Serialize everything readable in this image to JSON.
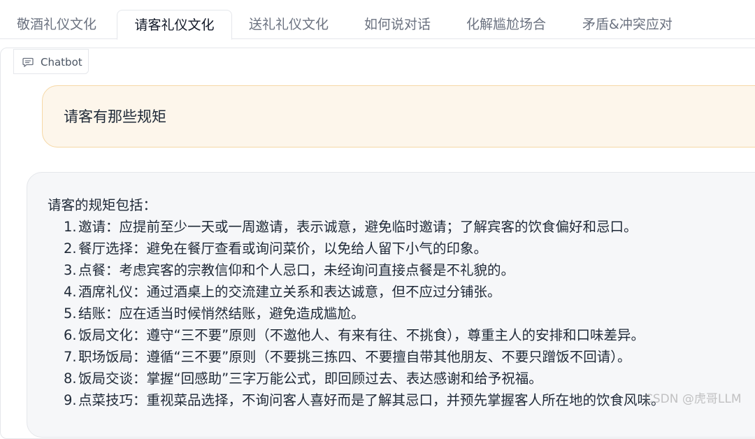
{
  "tabs": [
    {
      "label": "敬酒礼仪文化",
      "active": false
    },
    {
      "label": "请客礼仪文化",
      "active": true
    },
    {
      "label": "送礼礼仪文化",
      "active": false
    },
    {
      "label": "如何说对话",
      "active": false
    },
    {
      "label": "化解尴尬场合",
      "active": false
    },
    {
      "label": "矛盾&冲突应对",
      "active": false
    }
  ],
  "chatbot": {
    "label": "Chatbot",
    "icon": "chat-bubble-icon"
  },
  "messages": {
    "user": "请客有那些规矩",
    "bot": {
      "intro": "请客的规矩包括：",
      "items": [
        {
          "num": "1.",
          "text": "邀请：应提前至少一天或一周邀请，表示诚意，避免临时邀请；了解宾客的饮食偏好和忌口。"
        },
        {
          "num": "2.",
          "text": "餐厅选择：避免在餐厅查看或询问菜价，以免给人留下小气的印象。"
        },
        {
          "num": "3.",
          "text": "点餐：考虑宾客的宗教信仰和个人忌口，未经询问直接点餐是不礼貌的。"
        },
        {
          "num": "4.",
          "text": "酒席礼仪：通过酒桌上的交流建立关系和表达诚意，但不应过分铺张。"
        },
        {
          "num": "5.",
          "text": "结账：应在适当时候悄然结账，避免造成尴尬。"
        },
        {
          "num": "6.",
          "text": "饭局文化：遵守“三不要”原则（不邀他人、有来有往、不挑食），尊重主人的安排和口味差异。"
        },
        {
          "num": "7.",
          "text": "职场饭局：遵循“三不要”原则（不要挑三拣四、不要擅自带其他朋友、不要只蹭饭不回请）。"
        },
        {
          "num": "8.",
          "text": "饭局交谈：掌握“回感助”三字万能公式，即回顾过去、表达感谢和给予祝福。"
        },
        {
          "num": "9.",
          "text": "点菜技巧：重视菜品选择，不询问客人喜好而是了解其忌口，并预先掌握客人所在地的饮食风味。"
        }
      ]
    }
  },
  "watermark": "CSDN @虎哥LLM"
}
